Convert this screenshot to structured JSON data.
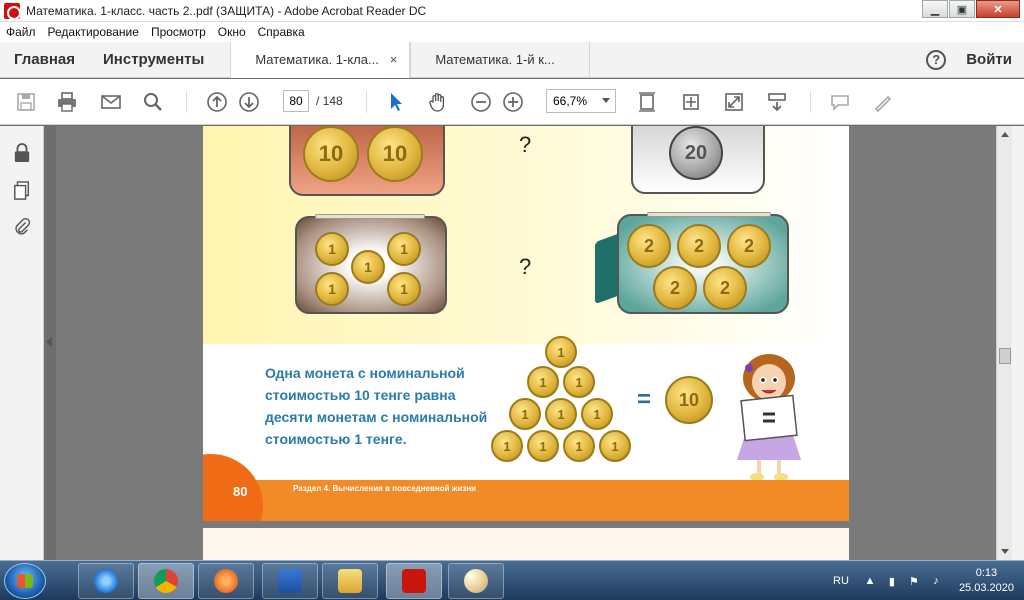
{
  "window": {
    "title": "Математика. 1-класс. часть 2..pdf (ЗАЩИТА) - Adobe Acrobat Reader DC",
    "minimize": "▁",
    "restore": "▣",
    "close": "✕"
  },
  "menu": [
    "Файл",
    "Редактирование",
    "Просмотр",
    "Окно",
    "Справка"
  ],
  "tabs": {
    "home": "Главная",
    "tools": "Инструменты",
    "doc1": "Математика. 1-кла...",
    "doc1_close": "×",
    "doc2": "Математика. 1-й к...",
    "help": "?",
    "signin": "Войти"
  },
  "toolbar": {
    "page_current": "80",
    "page_total": "/ 148",
    "zoom": "66,7%"
  },
  "page": {
    "question1": "?",
    "question2": "?",
    "coins_tl": [
      "10",
      "10"
    ],
    "coin_tr": "20",
    "coins_bl": [
      "1",
      "1",
      "1",
      "1",
      "1"
    ],
    "coins_br": [
      "2",
      "2",
      "2",
      "2",
      "2"
    ],
    "caption": "Одна монета с номинальной стоимостью 10 тенге равна десяти монетам с номинальной стоимостью 1 тенге.",
    "pyramid": [
      "1",
      "1",
      "1",
      "1",
      "1",
      "1",
      "1",
      "1",
      "1",
      "1"
    ],
    "equals": "=",
    "coin_ten": "10",
    "board_equals": "=",
    "page_number": "80",
    "section": "Раздел 4. Вычисления в повседневной жизни"
  },
  "taskbar": {
    "lang": "RU",
    "time": "0:13",
    "date": "25.03.2020"
  }
}
